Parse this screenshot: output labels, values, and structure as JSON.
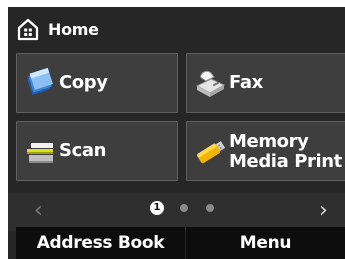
{
  "header": {
    "title": "Home",
    "icon": "home-icon"
  },
  "tiles": [
    {
      "label": "Copy",
      "icon": "copy-icon"
    },
    {
      "label": "Fax",
      "icon": "fax-icon"
    },
    {
      "label": "Scan",
      "icon": "scan-icon"
    },
    {
      "label_line1": "Memory",
      "label_line2": "Media Print",
      "icon": "memory-media-icon"
    }
  ],
  "pager": {
    "current_page": "1",
    "page_count": 3,
    "prev": "‹",
    "next": "›"
  },
  "bottom": {
    "left_label": "Address Book",
    "right_label": "Menu"
  },
  "colors": {
    "background": "#262626",
    "tile": "#3e3e3e",
    "tile_border": "#5f5f5f",
    "bottom_bar": "#0d0d0d",
    "text": "#ffffff"
  }
}
